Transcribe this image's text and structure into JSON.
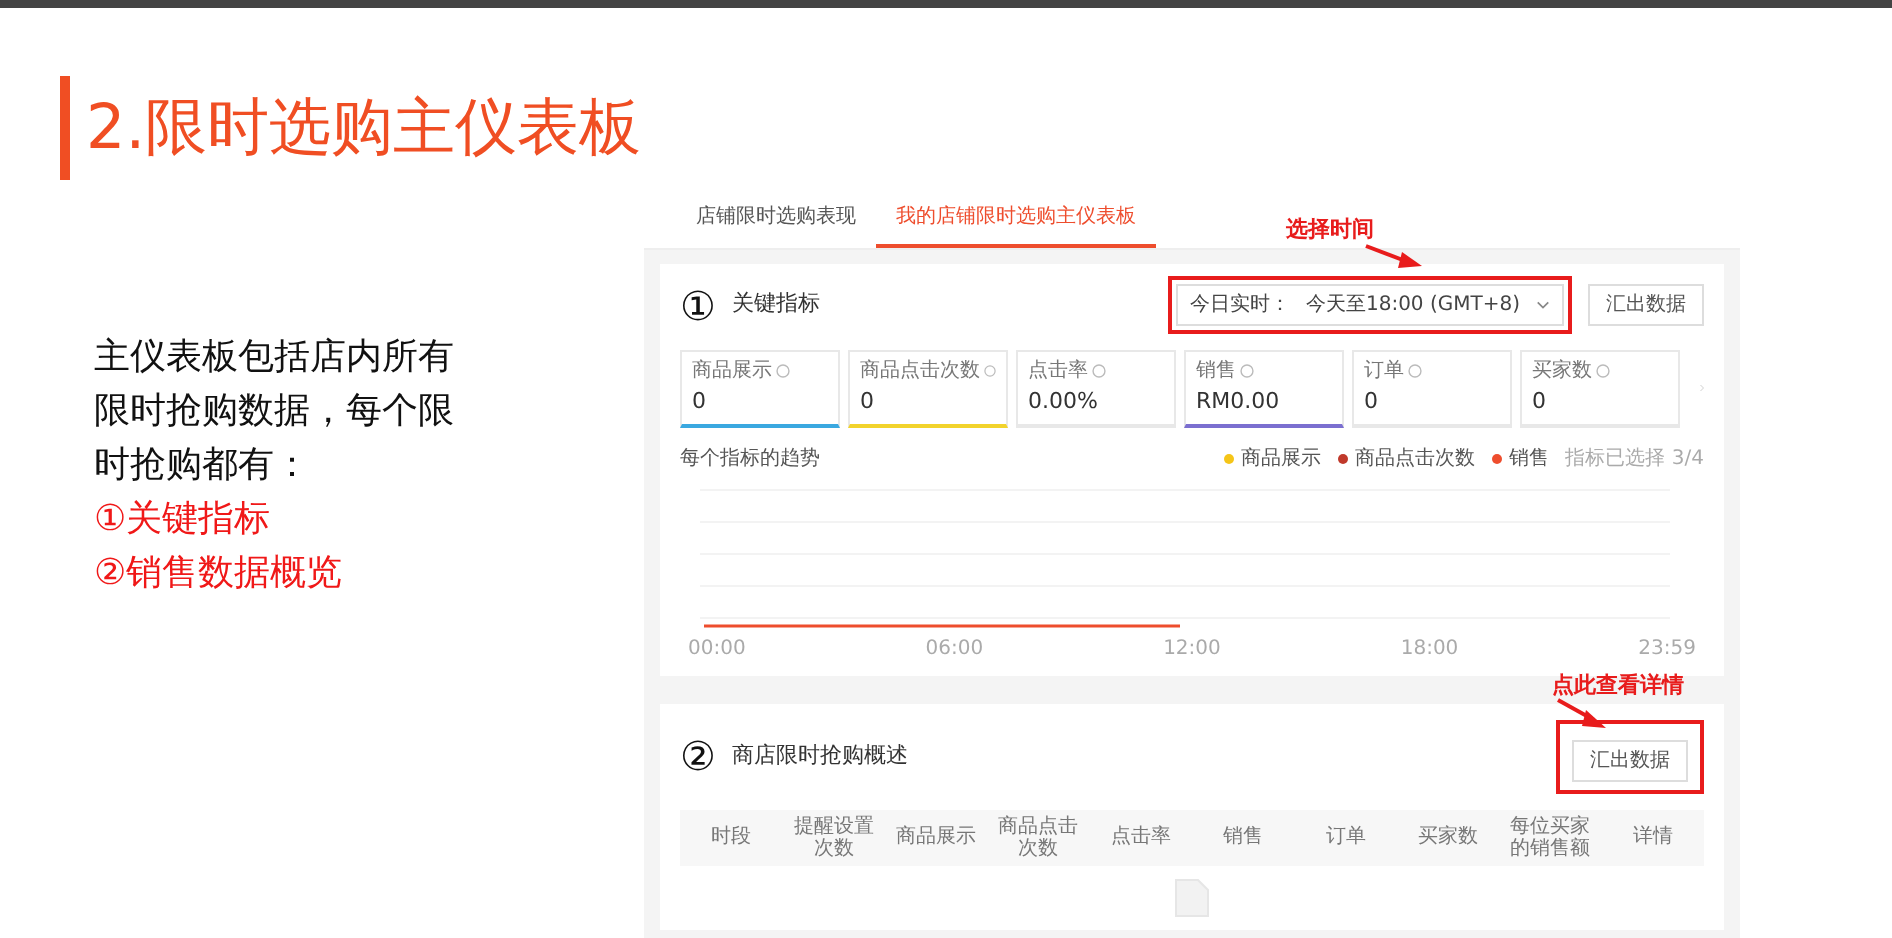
{
  "title": "2.限时选购主仪表板",
  "description": {
    "lines": [
      "主仪表板包括店内所有",
      "限时抢购数据，每个限",
      "时抢购都有："
    ],
    "highlights": [
      "①关键指标",
      "②销售数据概览"
    ]
  },
  "screenshot": {
    "tabs": [
      {
        "label": "店铺限时选购表现",
        "selected": false
      },
      {
        "label": "我的店铺限时选购主仪表板",
        "selected": true
      }
    ],
    "key_metrics": {
      "marker": "①",
      "title": "关键指标",
      "annotation": "选择时间",
      "date_picker": {
        "label": "今日实时：",
        "value": "今天至18:00 (GMT+8)"
      },
      "export_button": "汇出数据",
      "metrics": [
        {
          "label": "商品展示",
          "value": "0",
          "color": "#3aa8e0"
        },
        {
          "label": "商品点击次数",
          "value": "0",
          "color": "#f2d32c"
        },
        {
          "label": "点击率",
          "value": "0.00%"
        },
        {
          "label": "销售",
          "value": "RM0.00",
          "color": "#7b6fd0"
        },
        {
          "label": "订单",
          "value": "0"
        },
        {
          "label": "买家数",
          "value": "0"
        }
      ],
      "chart": {
        "title": "每个指标的趋势",
        "legend": [
          {
            "label": "商品展示",
            "color": "#f5c518"
          },
          {
            "label": "商品点击次数",
            "color": "#c0392b"
          },
          {
            "label": "销售",
            "color": "#ee4d2d"
          }
        ],
        "legend_note": "指标已选择 3/4",
        "x_labels": [
          "00:00",
          "06:00",
          "12:00",
          "18:00",
          "23:59"
        ]
      }
    },
    "overview": {
      "marker": "②",
      "title": "商店限时抢购概述",
      "annotation": "点此查看详情",
      "export_button": "汇出数据",
      "columns": [
        "时段",
        "提醒设置次数",
        "商品展示",
        "商品点击次数",
        "点击率",
        "销售",
        "订单",
        "买家数",
        "每位买家的销售额",
        "详情"
      ]
    }
  }
}
